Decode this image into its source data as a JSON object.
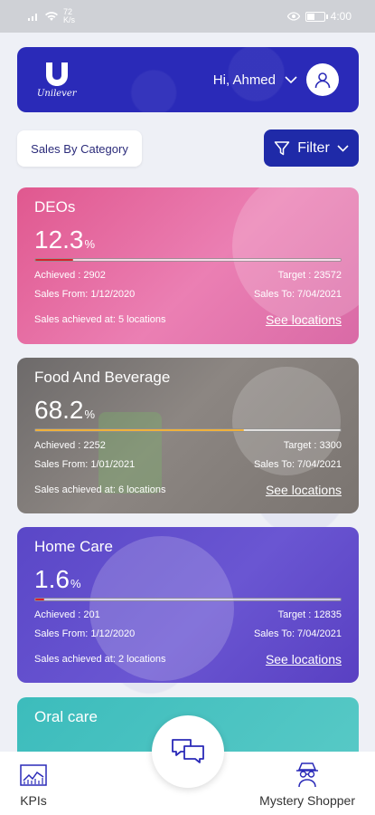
{
  "status_bar": {
    "time": "4:00",
    "speed": "72",
    "speed_unit": "K/s"
  },
  "header": {
    "brand": "Unilever",
    "greeting": "Hi, Ahmed"
  },
  "controls": {
    "category_label": "Sales By Category",
    "filter_label": "Filter"
  },
  "colors": {
    "primary": "#2a2ab8",
    "filter_bg": "#1f2aa8"
  },
  "cards": [
    {
      "title": "DEOs",
      "percent": "12.3",
      "percent_sign": "%",
      "progress": 0.123,
      "bar_color": "#d9202a",
      "achieved": "Achieved : 2902",
      "target": "Target : 23572",
      "sales_from": "Sales From:  1/12/2020",
      "sales_to": "Sales To:  7/04/2021",
      "locations": "Sales achieved at: 5 locations",
      "link": "See locations"
    },
    {
      "title": "Food And Beverage",
      "percent": "68.2",
      "percent_sign": "%",
      "progress": 0.682,
      "bar_color": "#f0b13b",
      "achieved": "Achieved : 2252",
      "target": "Target : 3300",
      "sales_from": "Sales From:  1/01/2021",
      "sales_to": "Sales To:  7/04/2021",
      "locations": "Sales achieved at: 6 locations",
      "link": "See locations"
    },
    {
      "title": "Home Care",
      "percent": "1.6",
      "percent_sign": "%",
      "progress": 0.016,
      "bar_color": "#d9202a",
      "achieved": "Achieved : 201",
      "target": "Target : 12835",
      "sales_from": "Sales From:  1/12/2020",
      "sales_to": "Sales To:  7/04/2021",
      "locations": "Sales achieved at: 2 locations",
      "link": "See locations"
    },
    {
      "title": "Oral care"
    }
  ],
  "nav": {
    "kpis": "KPIs",
    "mystery": "Mystery Shopper"
  },
  "icons": [
    "wifi-icon",
    "signal-icon",
    "eye-icon",
    "battery-icon",
    "chevron-down-icon",
    "user-icon",
    "filter-icon",
    "chat-icon",
    "chart-icon",
    "detective-icon"
  ]
}
